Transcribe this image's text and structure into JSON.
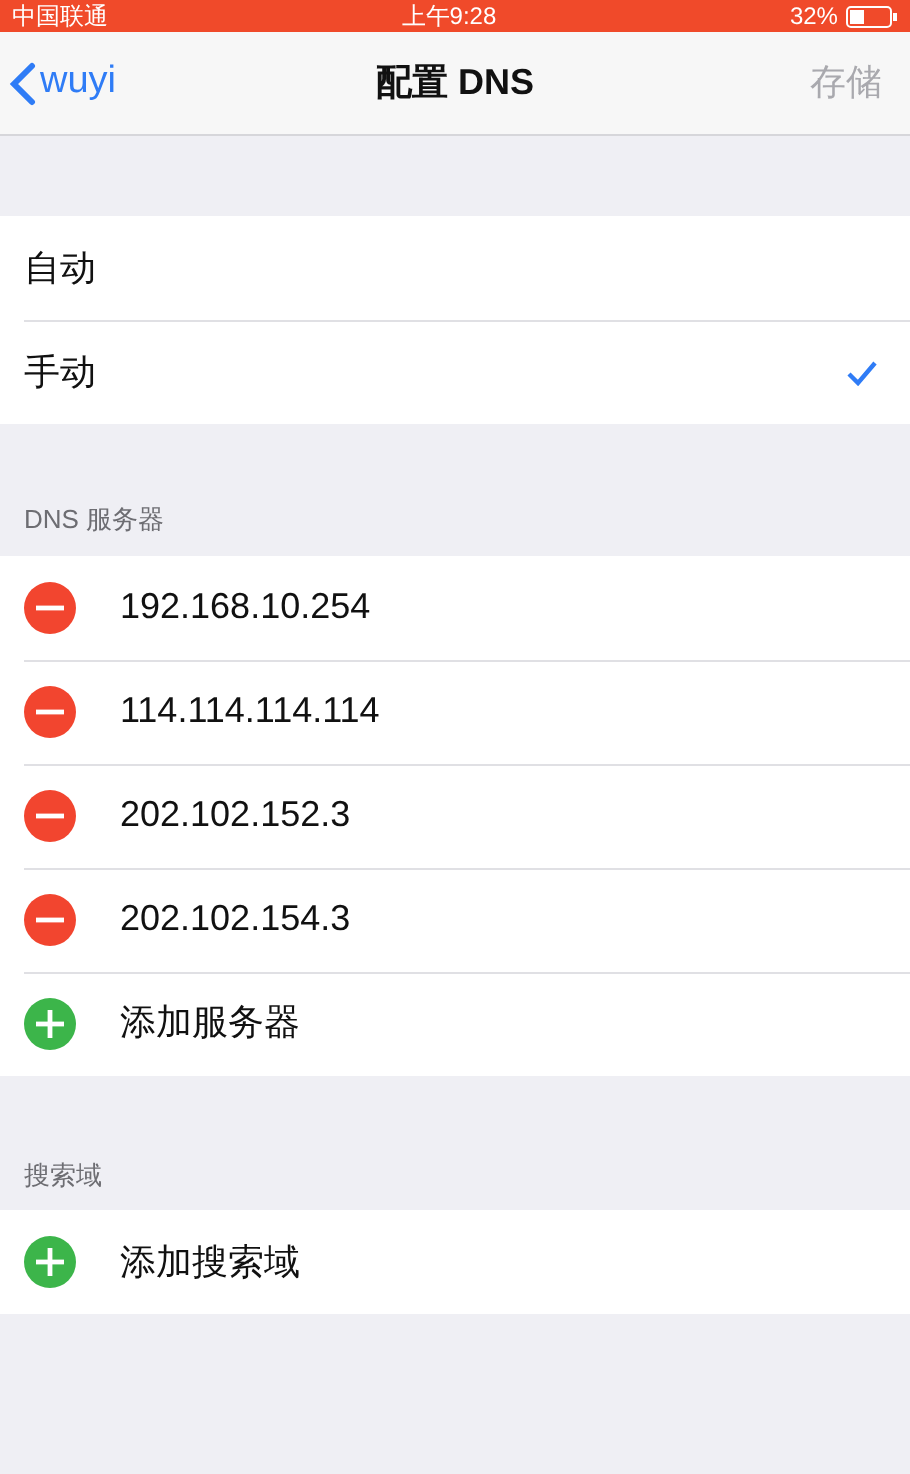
{
  "status_bar": {
    "carrier": "中国联通",
    "time": "上午9:28",
    "battery": "32%"
  },
  "nav": {
    "back": "wuyi",
    "title": "配置 DNS",
    "save": {
      "label": "存储",
      "disabled": true
    }
  },
  "modes": [
    {
      "label": "自动",
      "selected": false
    },
    {
      "label": "手动",
      "selected": true
    }
  ],
  "dns_section": {
    "header": "DNS 服务器",
    "rows": [
      {
        "kind": "remove",
        "label": "192.168.10.254"
      },
      {
        "kind": "remove",
        "label": "114.114.114.114"
      },
      {
        "kind": "remove",
        "label": "202.102.152.3"
      },
      {
        "kind": "remove",
        "label": "202.102.154.3"
      },
      {
        "kind": "add",
        "label": "添加服务器"
      }
    ]
  },
  "search_section": {
    "header": "搜索域",
    "rows": [
      {
        "kind": "add",
        "label": "添加搜索域"
      }
    ]
  }
}
